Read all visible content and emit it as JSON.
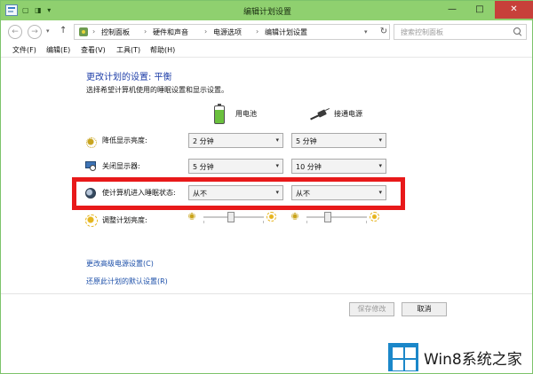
{
  "window": {
    "title": "编辑计划设置",
    "title_tools": "▢ ◨ ▾",
    "minimize": "—",
    "maximize": "□",
    "close": "✕"
  },
  "address": {
    "back": "←",
    "forward": "→",
    "up": "↑",
    "dropdown": "▾",
    "crumbs": [
      "控制面板",
      "硬件和声音",
      "电源选项",
      "编辑计划设置"
    ],
    "separator": "›",
    "refresh": "↻",
    "search_placeholder": "搜索控制面板"
  },
  "menu": [
    "文件(F)",
    "编辑(E)",
    "查看(V)",
    "工具(T)",
    "帮助(H)"
  ],
  "page": {
    "title": "更改计划的设置: 平衡",
    "subtitle": "选择希望计算机使用的睡眠设置和显示设置。",
    "col_battery": "用电池",
    "col_ac": "接通电源"
  },
  "rows": [
    {
      "label": "降低显示亮度:",
      "battery": "2 分钟",
      "ac": "5 分钟",
      "icon": "dim-display-icon"
    },
    {
      "label": "关闭显示器:",
      "battery": "5 分钟",
      "ac": "10 分钟",
      "icon": "monitor-icon"
    },
    {
      "label": "使计算机进入睡眠状态:",
      "battery": "从不",
      "ac": "从不",
      "icon": "sleep-moon-icon"
    }
  ],
  "brightness": {
    "label": "调整计划亮度:",
    "battery_level": 0.45,
    "ac_level": 0.35
  },
  "links": {
    "advanced": "更改高级电源设置(C)",
    "restore": "还原此计划的默认设置(R)"
  },
  "buttons": {
    "save": "保存修改",
    "cancel": "取消"
  },
  "watermark": {
    "text": "Win8系统之家"
  },
  "colors": {
    "titlebar": "#8fd06f",
    "highlight": "#e8191a",
    "link": "#1c4fa9",
    "title_text": "#1e3ea8"
  }
}
